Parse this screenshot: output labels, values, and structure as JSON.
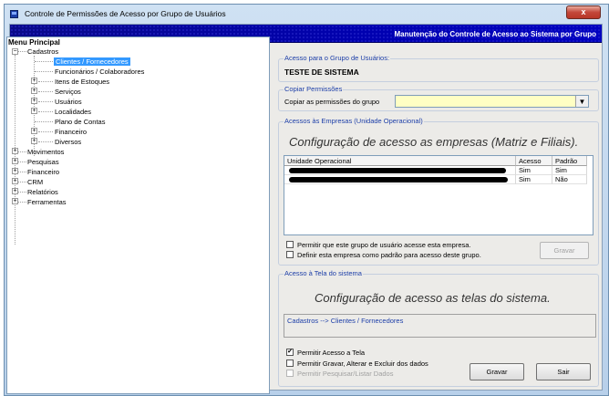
{
  "window": {
    "title": "Controle de Permissões de Acesso por Grupo de Usuários",
    "close_label": "x"
  },
  "banner": {
    "text": "Manutenção do Controle de Acesso ao Sistema por Grupo"
  },
  "tree": {
    "root": "Menu Principal",
    "cadastros": "Cadastros",
    "cadastros_children": [
      "Clientes / Fornecedores",
      "Funcionários / Colaboradores",
      "Itens de Estoques",
      "Serviços",
      "Usuários",
      "Localidades",
      "Plano de Contas",
      "Financeiro",
      "Diversos"
    ],
    "top_items": [
      "Movimentos",
      "Pesquisas",
      "Financeiro",
      "CRM",
      "Relatórios",
      "Ferramentas"
    ],
    "selected": "Clientes / Fornecedores"
  },
  "group_section": {
    "legend": "Acesso para o Grupo de Usuários:",
    "group_name": "TESTE DE SISTEMA"
  },
  "copy_section": {
    "legend": "Copiar Permissões",
    "label": "Copiar as permissões do grupo",
    "value": ""
  },
  "companies_section": {
    "legend": "Acessos às Empresas (Unidade Operacional)",
    "title": "Configuração de acesso as empresas (Matriz e Filiais).",
    "columns": [
      "Unidade Operacional",
      "Acesso",
      "Padrão"
    ],
    "rows": [
      {
        "acesso": "Sim",
        "padrao": "Sim"
      },
      {
        "acesso": "Sim",
        "padrao": "Não"
      }
    ],
    "check_permitir": "Permitir que este grupo de usuário acesse esta empresa.",
    "check_definir": "Definir esta empresa como padrão para acesso deste grupo.",
    "gravar_label": "Gravar"
  },
  "screen_section": {
    "legend": "Acesso à Tela do sistema",
    "title": "Configuração de acesso as telas do sistema.",
    "path": "Cadastros --> Clientes / Fornecedores",
    "check_acesso": "Permitir Acesso a Tela",
    "check_gravar": "Permitir Gravar, Alterar e Excluir dos dados",
    "check_pesquisar": "Permitir Pesquisar/Listar Dados",
    "gravar_label": "Gravar",
    "sair_label": "Sair",
    "acesso_checked": "✔"
  },
  "colors": {
    "banner": "#0000b0",
    "accent": "#1c3ea8",
    "selection": "#3399ff",
    "combo_bg": "#ffffc4"
  }
}
